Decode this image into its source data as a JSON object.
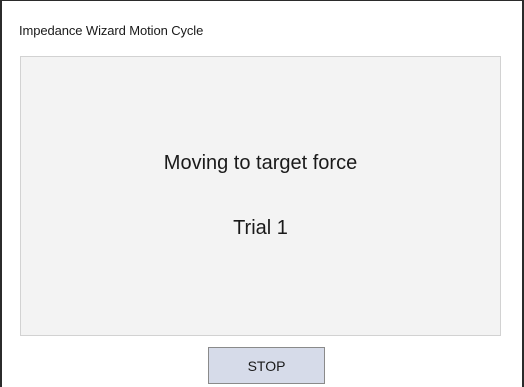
{
  "window": {
    "title": "Impedance Wizard Motion Cycle"
  },
  "status": {
    "message": "Moving to target force",
    "trial": "Trial 1"
  },
  "controls": {
    "stop_label": "STOP"
  },
  "colors": {
    "panel_background": "#f3f3f3",
    "button_background": "#d6dbe9"
  }
}
